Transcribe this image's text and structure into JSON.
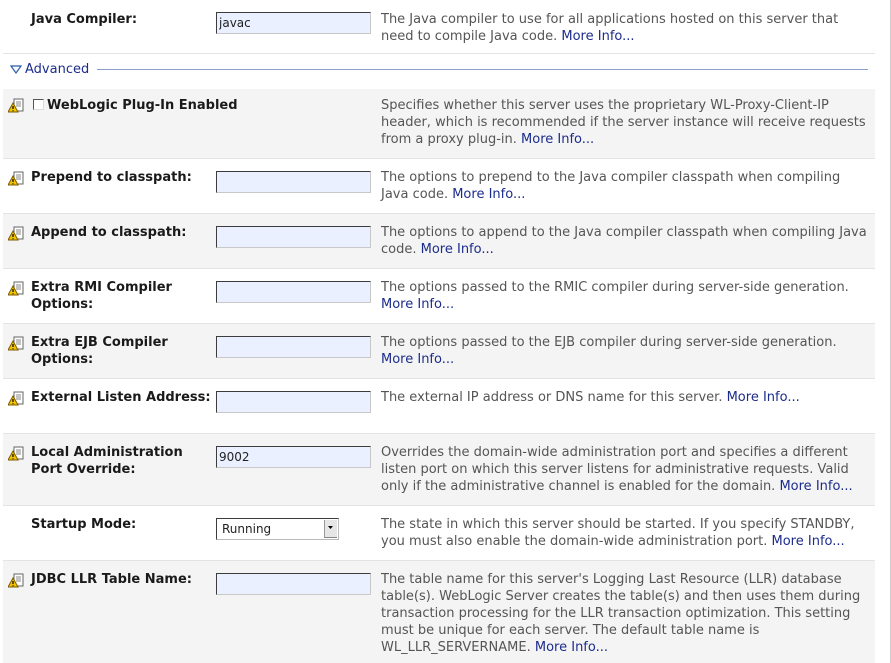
{
  "java_compiler": {
    "label": "Java Compiler:",
    "value": "javac",
    "desc": "The Java compiler to use for all applications hosted on this server that need to compile Java code.",
    "more": "More Info..."
  },
  "advanced": {
    "label": "Advanced"
  },
  "weblogic_plugin": {
    "label": "WebLogic Plug-In Enabled",
    "checked": false,
    "desc": "Specifies whether this server uses the proprietary WL-Proxy-Client-IP header, which is recommended if the server instance will receive requests from a proxy plug-in.",
    "more": "More Info..."
  },
  "prepend_classpath": {
    "label": "Prepend to classpath:",
    "value": "",
    "desc": "The options to prepend to the Java compiler classpath when compiling Java code.",
    "more": "More Info..."
  },
  "append_classpath": {
    "label": "Append to classpath:",
    "value": "",
    "desc": "The options to append to the Java compiler classpath when compiling Java code.",
    "more": "More Info..."
  },
  "extra_rmi": {
    "label": "Extra RMI Compiler Options:",
    "value": "",
    "desc": "The options passed to the RMIC compiler during server-side generation.",
    "more": "More Info..."
  },
  "extra_ejb": {
    "label": "Extra EJB Compiler Options:",
    "value": "",
    "desc": "The options passed to the EJB compiler during server-side generation.",
    "more": "More Info..."
  },
  "external_listen": {
    "label": "External Listen Address:",
    "value": "",
    "desc": "The external IP address or DNS name for this server.",
    "more": "More Info..."
  },
  "local_admin_port": {
    "label": "Local Administration Port Override:",
    "value": "9002",
    "desc": "Overrides the domain-wide administration port and specifies a different listen port on which this server listens for administrative requests. Valid only if the administrative channel is enabled for the domain.",
    "more": "More Info..."
  },
  "startup_mode": {
    "label": "Startup Mode:",
    "value": "Running",
    "desc": "The state in which this server should be started. If you specify STANDBY, you must also enable the domain-wide administration port.",
    "more": "More Info..."
  },
  "jdbc_llr": {
    "label": "JDBC LLR Table Name:",
    "value": "",
    "desc": "The table name for this server's Logging Last Resource (LLR) database table(s). WebLogic Server creates the table(s) and then uses them during transaction processing for the LLR transaction optimization. This setting must be unique for each server. The default table name is WL_LLR_SERVERNAME.",
    "more": "More Info..."
  },
  "colors": {
    "link": "#1c2c8c",
    "input_bg": "#eaf0ff",
    "row_shaded": "#f4f4f4"
  },
  "icons": {
    "warning": "restart-required-warning-icon",
    "section_toggle": "triangle-down-icon"
  }
}
